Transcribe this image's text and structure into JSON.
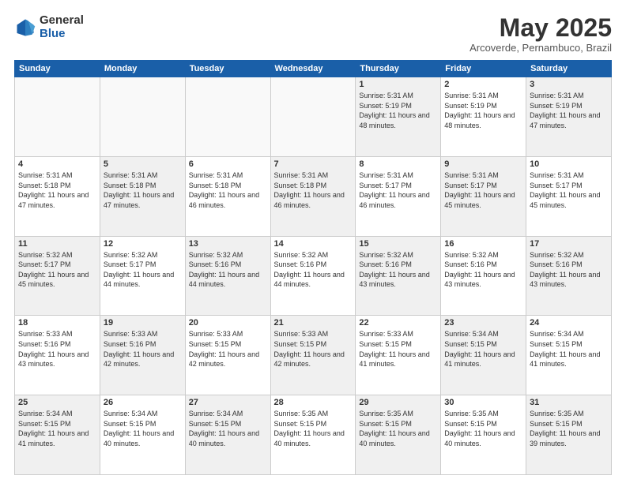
{
  "logo": {
    "general": "General",
    "blue": "Blue"
  },
  "header": {
    "title": "May 2025",
    "subtitle": "Arcoverde, Pernambuco, Brazil"
  },
  "weekdays": [
    "Sunday",
    "Monday",
    "Tuesday",
    "Wednesday",
    "Thursday",
    "Friday",
    "Saturday"
  ],
  "rows": [
    [
      {
        "day": "",
        "info": "",
        "empty": true
      },
      {
        "day": "",
        "info": "",
        "empty": true
      },
      {
        "day": "",
        "info": "",
        "empty": true
      },
      {
        "day": "",
        "info": "",
        "empty": true
      },
      {
        "day": "1",
        "info": "Sunrise: 5:31 AM\nSunset: 5:19 PM\nDaylight: 11 hours\nand 48 minutes."
      },
      {
        "day": "2",
        "info": "Sunrise: 5:31 AM\nSunset: 5:19 PM\nDaylight: 11 hours\nand 48 minutes."
      },
      {
        "day": "3",
        "info": "Sunrise: 5:31 AM\nSunset: 5:19 PM\nDaylight: 11 hours\nand 47 minutes."
      }
    ],
    [
      {
        "day": "4",
        "info": "Sunrise: 5:31 AM\nSunset: 5:18 PM\nDaylight: 11 hours\nand 47 minutes."
      },
      {
        "day": "5",
        "info": "Sunrise: 5:31 AM\nSunset: 5:18 PM\nDaylight: 11 hours\nand 47 minutes."
      },
      {
        "day": "6",
        "info": "Sunrise: 5:31 AM\nSunset: 5:18 PM\nDaylight: 11 hours\nand 46 minutes."
      },
      {
        "day": "7",
        "info": "Sunrise: 5:31 AM\nSunset: 5:18 PM\nDaylight: 11 hours\nand 46 minutes."
      },
      {
        "day": "8",
        "info": "Sunrise: 5:31 AM\nSunset: 5:17 PM\nDaylight: 11 hours\nand 46 minutes."
      },
      {
        "day": "9",
        "info": "Sunrise: 5:31 AM\nSunset: 5:17 PM\nDaylight: 11 hours\nand 45 minutes."
      },
      {
        "day": "10",
        "info": "Sunrise: 5:31 AM\nSunset: 5:17 PM\nDaylight: 11 hours\nand 45 minutes."
      }
    ],
    [
      {
        "day": "11",
        "info": "Sunrise: 5:32 AM\nSunset: 5:17 PM\nDaylight: 11 hours\nand 45 minutes."
      },
      {
        "day": "12",
        "info": "Sunrise: 5:32 AM\nSunset: 5:17 PM\nDaylight: 11 hours\nand 44 minutes."
      },
      {
        "day": "13",
        "info": "Sunrise: 5:32 AM\nSunset: 5:16 PM\nDaylight: 11 hours\nand 44 minutes."
      },
      {
        "day": "14",
        "info": "Sunrise: 5:32 AM\nSunset: 5:16 PM\nDaylight: 11 hours\nand 44 minutes."
      },
      {
        "day": "15",
        "info": "Sunrise: 5:32 AM\nSunset: 5:16 PM\nDaylight: 11 hours\nand 43 minutes."
      },
      {
        "day": "16",
        "info": "Sunrise: 5:32 AM\nSunset: 5:16 PM\nDaylight: 11 hours\nand 43 minutes."
      },
      {
        "day": "17",
        "info": "Sunrise: 5:32 AM\nSunset: 5:16 PM\nDaylight: 11 hours\nand 43 minutes."
      }
    ],
    [
      {
        "day": "18",
        "info": "Sunrise: 5:33 AM\nSunset: 5:16 PM\nDaylight: 11 hours\nand 43 minutes."
      },
      {
        "day": "19",
        "info": "Sunrise: 5:33 AM\nSunset: 5:16 PM\nDaylight: 11 hours\nand 42 minutes."
      },
      {
        "day": "20",
        "info": "Sunrise: 5:33 AM\nSunset: 5:15 PM\nDaylight: 11 hours\nand 42 minutes."
      },
      {
        "day": "21",
        "info": "Sunrise: 5:33 AM\nSunset: 5:15 PM\nDaylight: 11 hours\nand 42 minutes."
      },
      {
        "day": "22",
        "info": "Sunrise: 5:33 AM\nSunset: 5:15 PM\nDaylight: 11 hours\nand 41 minutes."
      },
      {
        "day": "23",
        "info": "Sunrise: 5:34 AM\nSunset: 5:15 PM\nDaylight: 11 hours\nand 41 minutes."
      },
      {
        "day": "24",
        "info": "Sunrise: 5:34 AM\nSunset: 5:15 PM\nDaylight: 11 hours\nand 41 minutes."
      }
    ],
    [
      {
        "day": "25",
        "info": "Sunrise: 5:34 AM\nSunset: 5:15 PM\nDaylight: 11 hours\nand 41 minutes."
      },
      {
        "day": "26",
        "info": "Sunrise: 5:34 AM\nSunset: 5:15 PM\nDaylight: 11 hours\nand 40 minutes."
      },
      {
        "day": "27",
        "info": "Sunrise: 5:34 AM\nSunset: 5:15 PM\nDaylight: 11 hours\nand 40 minutes."
      },
      {
        "day": "28",
        "info": "Sunrise: 5:35 AM\nSunset: 5:15 PM\nDaylight: 11 hours\nand 40 minutes."
      },
      {
        "day": "29",
        "info": "Sunrise: 5:35 AM\nSunset: 5:15 PM\nDaylight: 11 hours\nand 40 minutes."
      },
      {
        "day": "30",
        "info": "Sunrise: 5:35 AM\nSunset: 5:15 PM\nDaylight: 11 hours\nand 40 minutes."
      },
      {
        "day": "31",
        "info": "Sunrise: 5:35 AM\nSunset: 5:15 PM\nDaylight: 11 hours\nand 39 minutes."
      }
    ]
  ]
}
